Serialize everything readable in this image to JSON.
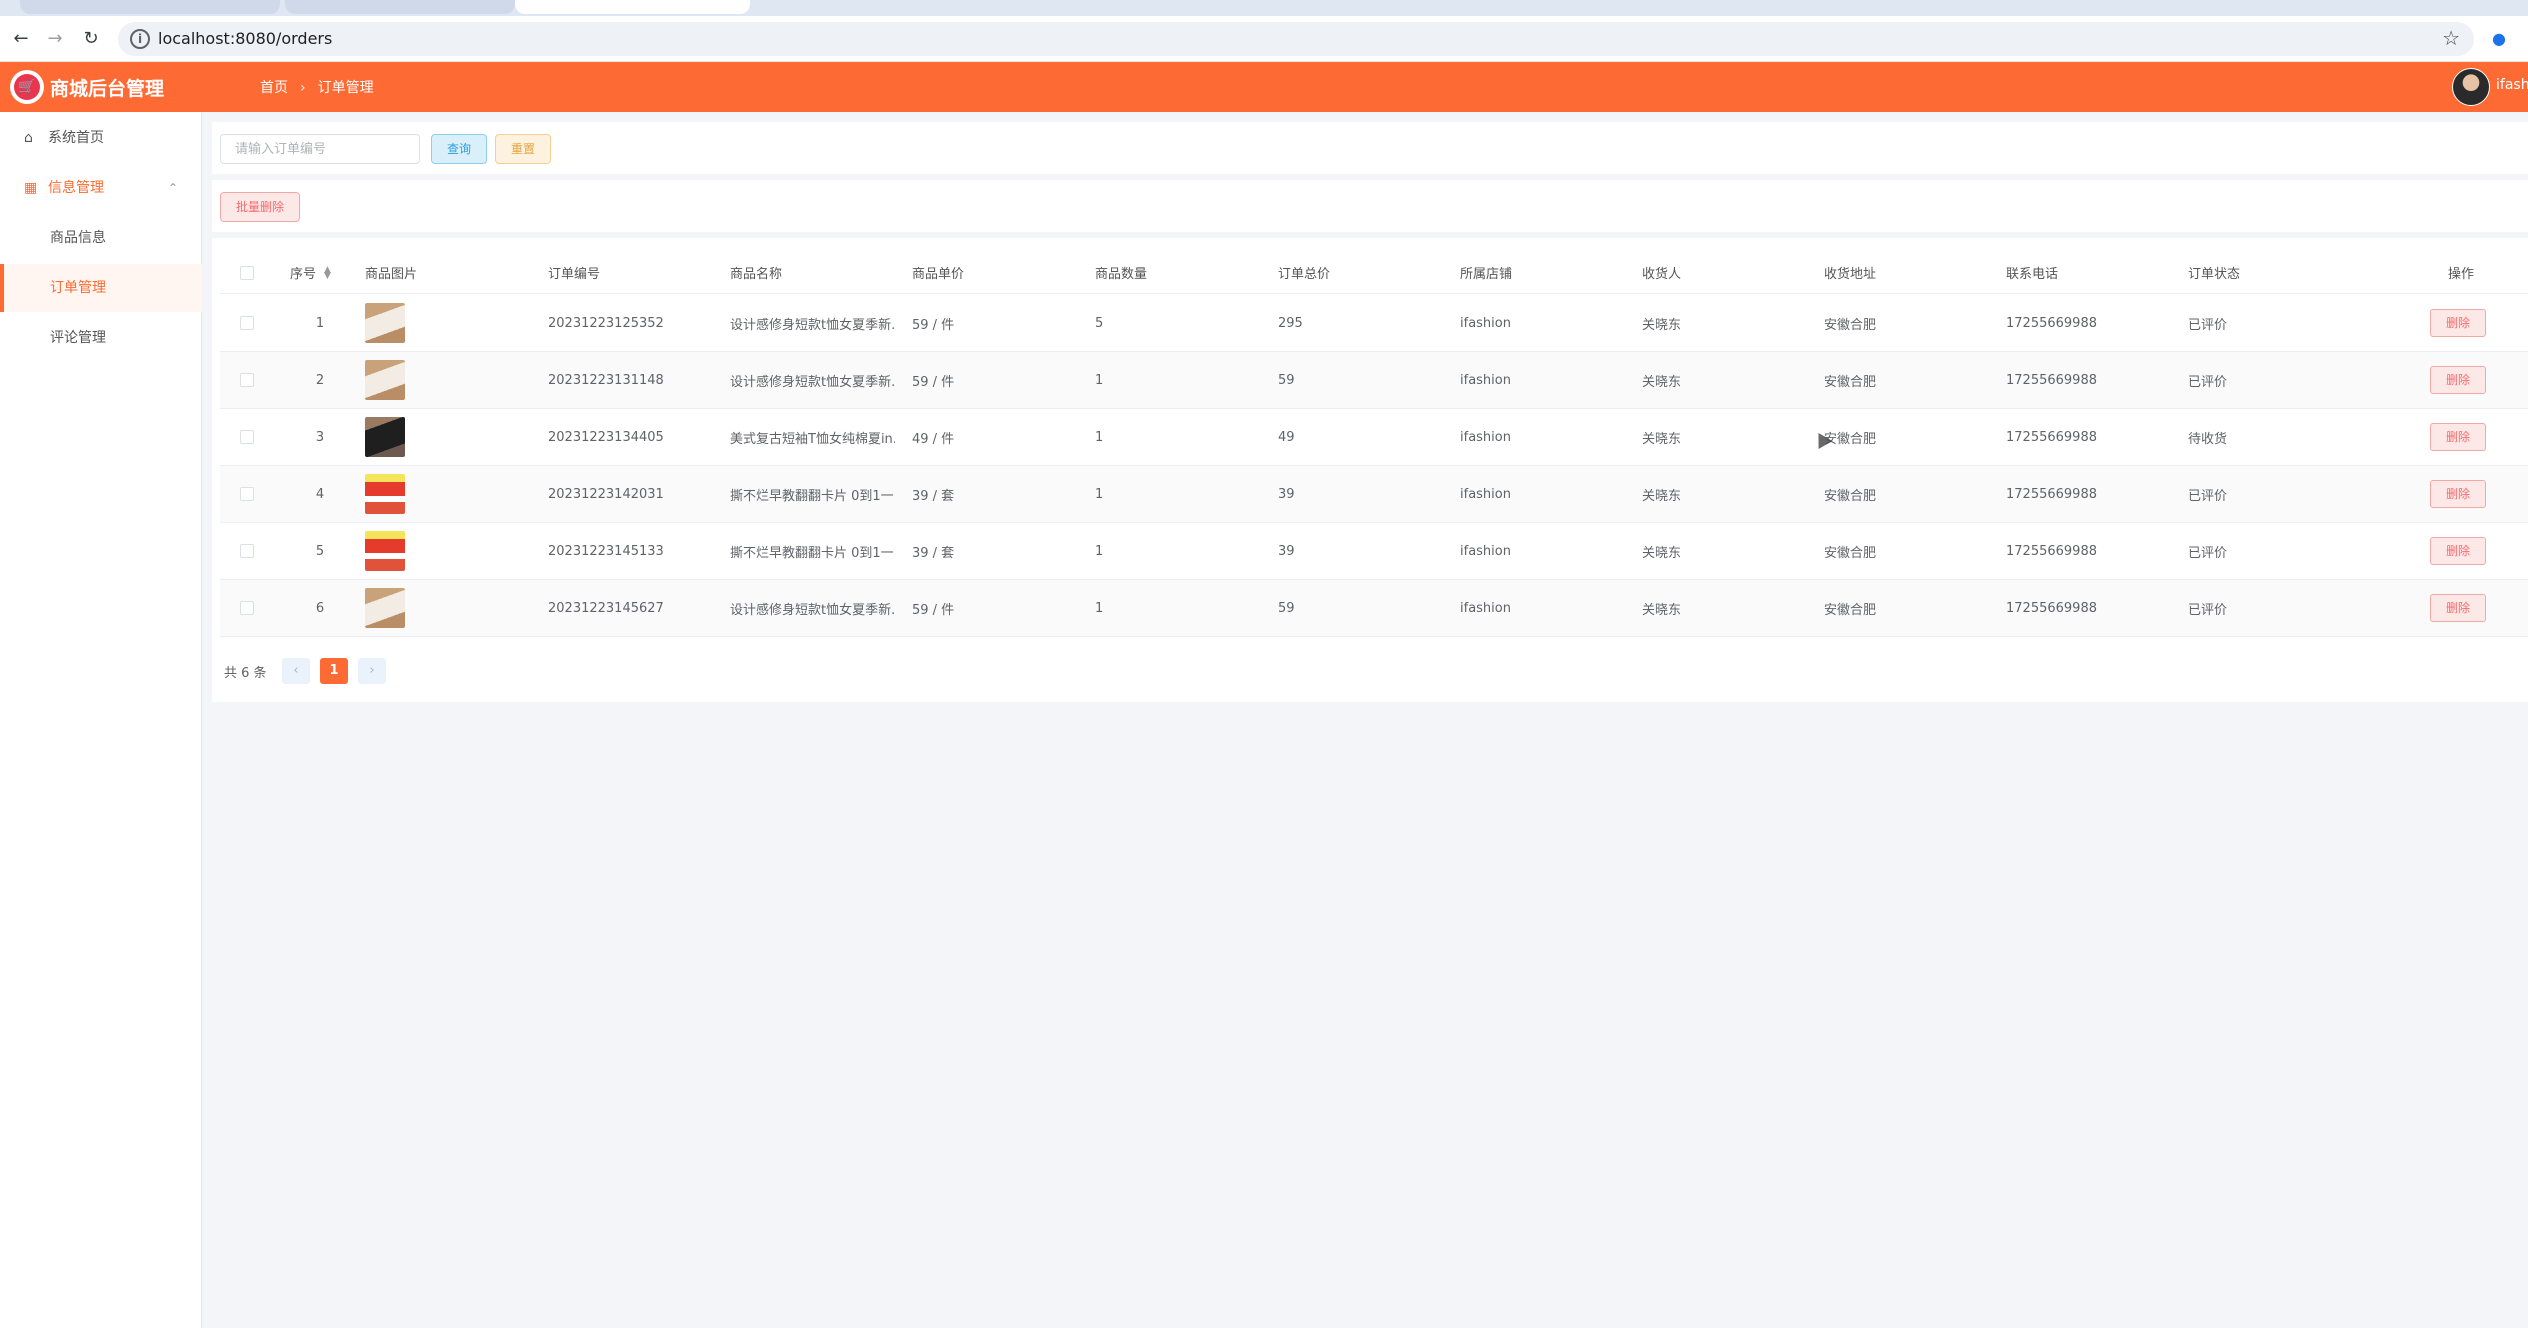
{
  "browser": {
    "url": "localhost:8080/orders"
  },
  "header": {
    "brand": "商城后台管理",
    "breadcrumb": [
      "首页",
      "订单管理"
    ],
    "user_name": "ifash"
  },
  "sidebar": {
    "home": "系统首页",
    "group": "信息管理",
    "items": [
      "商品信息",
      "订单管理",
      "评论管理"
    ]
  },
  "search": {
    "placeholder": "请输入订单编号",
    "query_label": "查询",
    "reset_label": "重置"
  },
  "actions": {
    "batch_delete_label": "批量删除"
  },
  "table": {
    "headers": [
      "序号",
      "商品图片",
      "订单编号",
      "商品名称",
      "商品单价",
      "商品数量",
      "订单总价",
      "所属店铺",
      "收货人",
      "收货地址",
      "联系电话",
      "订单状态",
      "操作"
    ],
    "rows": [
      {
        "index": "1",
        "thumb": "t-white",
        "order_no": "20231223125352",
        "name": "设计感修身短款t恤女夏季新...",
        "price": "59 / 件",
        "qty": "5",
        "total": "295",
        "shop": "ifashion",
        "receiver": "关晓东",
        "address": "安徽合肥",
        "phone": "17255669988",
        "status": "已评价",
        "action": "删除"
      },
      {
        "index": "2",
        "thumb": "t-white",
        "order_no": "20231223131148",
        "name": "设计感修身短款t恤女夏季新...",
        "price": "59 / 件",
        "qty": "1",
        "total": "59",
        "shop": "ifashion",
        "receiver": "关晓东",
        "address": "安徽合肥",
        "phone": "17255669988",
        "status": "已评价",
        "action": "删除"
      },
      {
        "index": "3",
        "thumb": "t-black",
        "order_no": "20231223134405",
        "name": "美式复古短袖T恤女纯棉夏in...",
        "price": "49 / 件",
        "qty": "1",
        "total": "49",
        "shop": "ifashion",
        "receiver": "关晓东",
        "address": "安徽合肥",
        "phone": "17255669988",
        "status": "待收货",
        "action": "删除"
      },
      {
        "index": "4",
        "thumb": "t-card",
        "order_no": "20231223142031",
        "name": "撕不烂早教翻翻卡片 0到1一...",
        "price": "39 / 套",
        "qty": "1",
        "total": "39",
        "shop": "ifashion",
        "receiver": "关晓东",
        "address": "安徽合肥",
        "phone": "17255669988",
        "status": "已评价",
        "action": "删除"
      },
      {
        "index": "5",
        "thumb": "t-card",
        "order_no": "20231223145133",
        "name": "撕不烂早教翻翻卡片 0到1一...",
        "price": "39 / 套",
        "qty": "1",
        "total": "39",
        "shop": "ifashion",
        "receiver": "关晓东",
        "address": "安徽合肥",
        "phone": "17255669988",
        "status": "已评价",
        "action": "删除"
      },
      {
        "index": "6",
        "thumb": "t-white",
        "order_no": "20231223145627",
        "name": "设计感修身短款t恤女夏季新...",
        "price": "59 / 件",
        "qty": "1",
        "total": "59",
        "shop": "ifashion",
        "receiver": "关晓东",
        "address": "安徽合肥",
        "phone": "17255669988",
        "status": "已评价",
        "action": "删除"
      }
    ]
  },
  "pagination": {
    "total_text": "共 6 条",
    "current_page": "1",
    "prev_icon": "‹",
    "next_icon": "›"
  },
  "colors": {
    "accent": "#fe6a33",
    "danger": "#f56c6c"
  }
}
